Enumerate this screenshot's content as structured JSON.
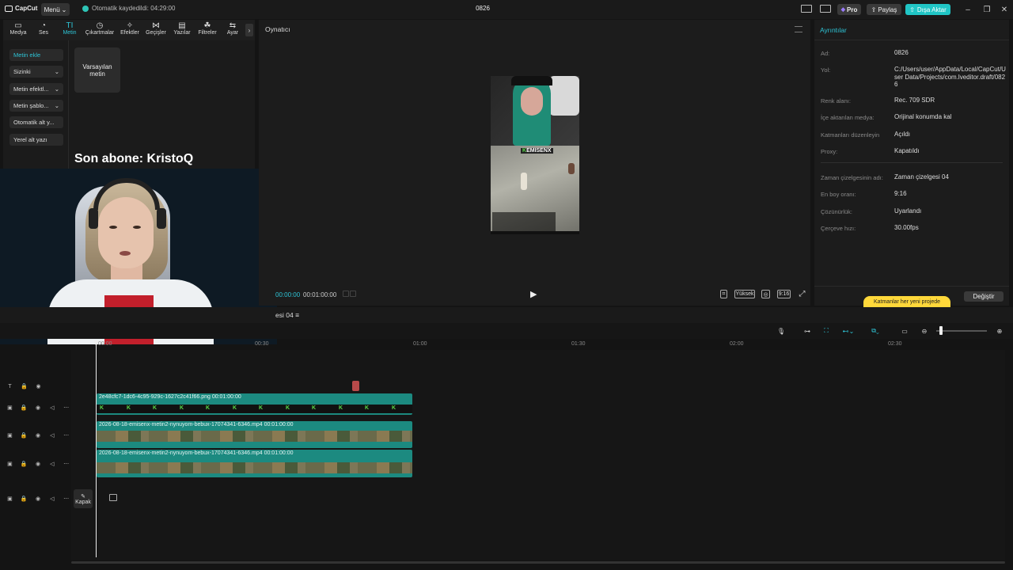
{
  "titlebar": {
    "logo": "CapCut",
    "menu_label": "Menü",
    "autosave": "Otomatik kaydedildi: 04:29:00",
    "project_name": "0826",
    "pro_label": "Pro",
    "share_label": "Paylaş",
    "export_label": "Dışa Aktar"
  },
  "toolbar": {
    "items": [
      {
        "label": "Medya",
        "icon": "▭"
      },
      {
        "label": "Ses",
        "icon": "◔"
      },
      {
        "label": "Metin",
        "icon": "TI"
      },
      {
        "label": "Çıkartmalar",
        "icon": "◷"
      },
      {
        "label": "Efektler",
        "icon": "✧"
      },
      {
        "label": "Geçişler",
        "icon": "⋈"
      },
      {
        "label": "Yazılar",
        "icon": "▤"
      },
      {
        "label": "Filtreler",
        "icon": "☘"
      },
      {
        "label": "Ayar",
        "icon": "⇆"
      }
    ],
    "active": "Metin",
    "accent": "#2ec4d6"
  },
  "leftpanel": {
    "items": [
      {
        "label": "Metin ekle"
      },
      {
        "label": "Sizinki"
      },
      {
        "label": "Metin efektl..."
      },
      {
        "label": "Metin şablo..."
      },
      {
        "label": "Otomatik alt y..."
      },
      {
        "label": "Yerel alt yazı"
      }
    ],
    "card_label": "Varsayılan metin",
    "overlay_text": "Son abone: KristoQ"
  },
  "player": {
    "title": "Oynatıcı",
    "current_time": "00:00:00",
    "total_time": "00:01:00:00",
    "quality": "Yüksek",
    "ratio": "9:16",
    "game_logo": "EMISENX"
  },
  "details": {
    "title": "Ayrıntılar",
    "rows": [
      {
        "label": "Ad:",
        "value": "0826"
      },
      {
        "label": "Yol:",
        "value": "C:/Users/user/AppData/Local/CapCut/User Data/Projects/com.lveditor.draft/0826"
      },
      {
        "label": "Renk alanı:",
        "value": "Rec. 709 SDR"
      },
      {
        "label": "İçe aktarılan medya:",
        "value": "Orijinal konumda kal"
      },
      {
        "label": "Katmanları düzenleyin",
        "value": "Açıldı"
      },
      {
        "label": "Proxy:",
        "value": "Kapatıldı"
      },
      {
        "label": "Zaman çizelgesinin adı:",
        "value": "Zaman çizelgesi 04"
      },
      {
        "label": "En boy oranı:",
        "value": "9:16"
      },
      {
        "label": "Çözünürlük:",
        "value": "Uyarlandı"
      },
      {
        "label": "Çerçeve hızı:",
        "value": "30.00fps"
      }
    ],
    "banner": "Katmanlar her yeni projede",
    "change_label": "Değiştir"
  },
  "timeline": {
    "name": "esi 04",
    "ticks": [
      "00:00",
      "00:30",
      "01:00",
      "01:30",
      "02:00",
      "02:30"
    ],
    "clips": [
      {
        "label": "2e48cfc7-1dc6-4c95-929c-1627c2c41f66.png   00:01:00:00"
      },
      {
        "label": "2026-08-18-emisenx-metin2-nynuyom-bebux-17074341-6346.mp4   00:01:00:00"
      },
      {
        "label": "2026-08-18-emisenx-metin2-nynuyom-bebux-17074341-6346.mp4   00:01:00:00"
      }
    ],
    "cover_label": "Kapak"
  }
}
